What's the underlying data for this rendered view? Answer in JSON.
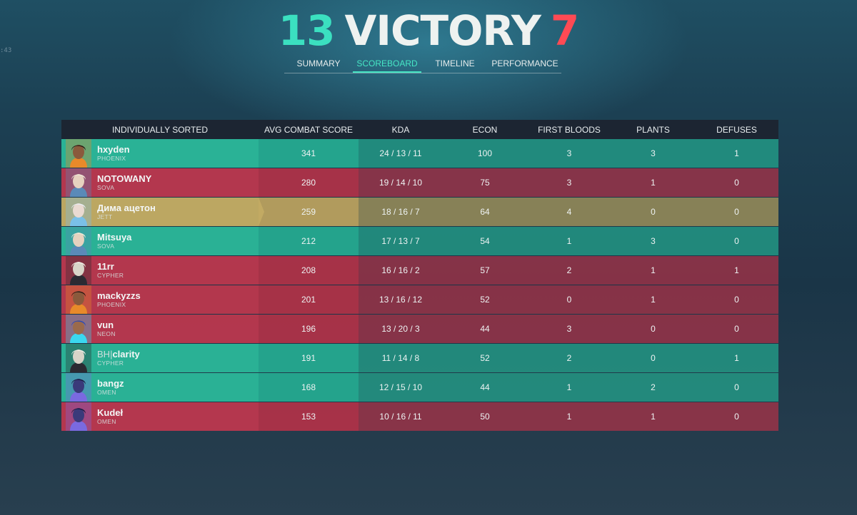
{
  "clock": ":43",
  "header": {
    "score_left": "13",
    "result": "VICTORY",
    "score_right": "7"
  },
  "tabs": [
    {
      "label": "SUMMARY"
    },
    {
      "label": "SCOREBOARD"
    },
    {
      "label": "TIMELINE"
    },
    {
      "label": "PERFORMANCE"
    }
  ],
  "table": {
    "headers": [
      "INDIVIDUALLY SORTED",
      "AVG COMBAT SCORE",
      "KDA",
      "ECON",
      "FIRST BLOODS",
      "PLANTS",
      "DEFUSES"
    ],
    "rows": [
      {
        "name": "hxyden",
        "agent": "PHOENIX",
        "acs": "341",
        "kda": "24 / 13 / 11",
        "econ": "100",
        "fb": "3",
        "plants": "3",
        "defuses": "1",
        "team": "win"
      },
      {
        "name": "NOTOWANY",
        "agent": "SOVA",
        "acs": "280",
        "kda": "19 / 14 / 10",
        "econ": "75",
        "fb": "3",
        "plants": "1",
        "defuses": "0",
        "team": "loss"
      },
      {
        "name": "Дима ацетон",
        "agent": "JETT",
        "acs": "259",
        "kda": "18 / 16 / 7",
        "econ": "64",
        "fb": "4",
        "plants": "0",
        "defuses": "0",
        "team": "me"
      },
      {
        "name": "Mitsuya",
        "agent": "SOVA",
        "acs": "212",
        "kda": "17 / 13 / 7",
        "econ": "54",
        "fb": "1",
        "plants": "3",
        "defuses": "0",
        "team": "win"
      },
      {
        "name": "11rr",
        "agent": "CYPHER",
        "acs": "208",
        "kda": "16 / 16 / 2",
        "econ": "57",
        "fb": "2",
        "plants": "1",
        "defuses": "1",
        "team": "loss"
      },
      {
        "name": "mackyzzs",
        "agent": "PHOENIX",
        "acs": "201",
        "kda": "13 / 16 / 12",
        "econ": "52",
        "fb": "0",
        "plants": "1",
        "defuses": "0",
        "team": "loss"
      },
      {
        "name": "vun",
        "agent": "NEON",
        "acs": "196",
        "kda": "13 / 20 / 3",
        "econ": "44",
        "fb": "3",
        "plants": "0",
        "defuses": "0",
        "team": "loss"
      },
      {
        "name_prefix": "BH",
        "name_sep": "|",
        "name": "clarity",
        "agent": "CYPHER",
        "acs": "191",
        "kda": "11 / 14 / 8",
        "econ": "52",
        "fb": "2",
        "plants": "0",
        "defuses": "1",
        "team": "win"
      },
      {
        "name": "bangz",
        "agent": "OMEN",
        "acs": "168",
        "kda": "12 / 15 / 10",
        "econ": "44",
        "fb": "1",
        "plants": "2",
        "defuses": "0",
        "team": "win"
      },
      {
        "name": "Kudeł",
        "agent": "OMEN",
        "acs": "153",
        "kda": "10 / 16 / 11",
        "econ": "50",
        "fb": "1",
        "plants": "1",
        "defuses": "0",
        "team": "loss"
      }
    ]
  },
  "colors": {
    "win": "#2bb99a",
    "loss": "#ba384f",
    "me": "#c4ac64",
    "accent": "#46e6c4",
    "victory_score": "#3be0c0",
    "defeat_score": "#ff4a54"
  },
  "icons": {
    "PHOENIX": "phoenix-agent-icon",
    "SOVA": "sova-agent-icon",
    "JETT": "jett-agent-icon",
    "CYPHER": "cypher-agent-icon",
    "NEON": "neon-agent-icon",
    "OMEN": "omen-agent-icon"
  }
}
